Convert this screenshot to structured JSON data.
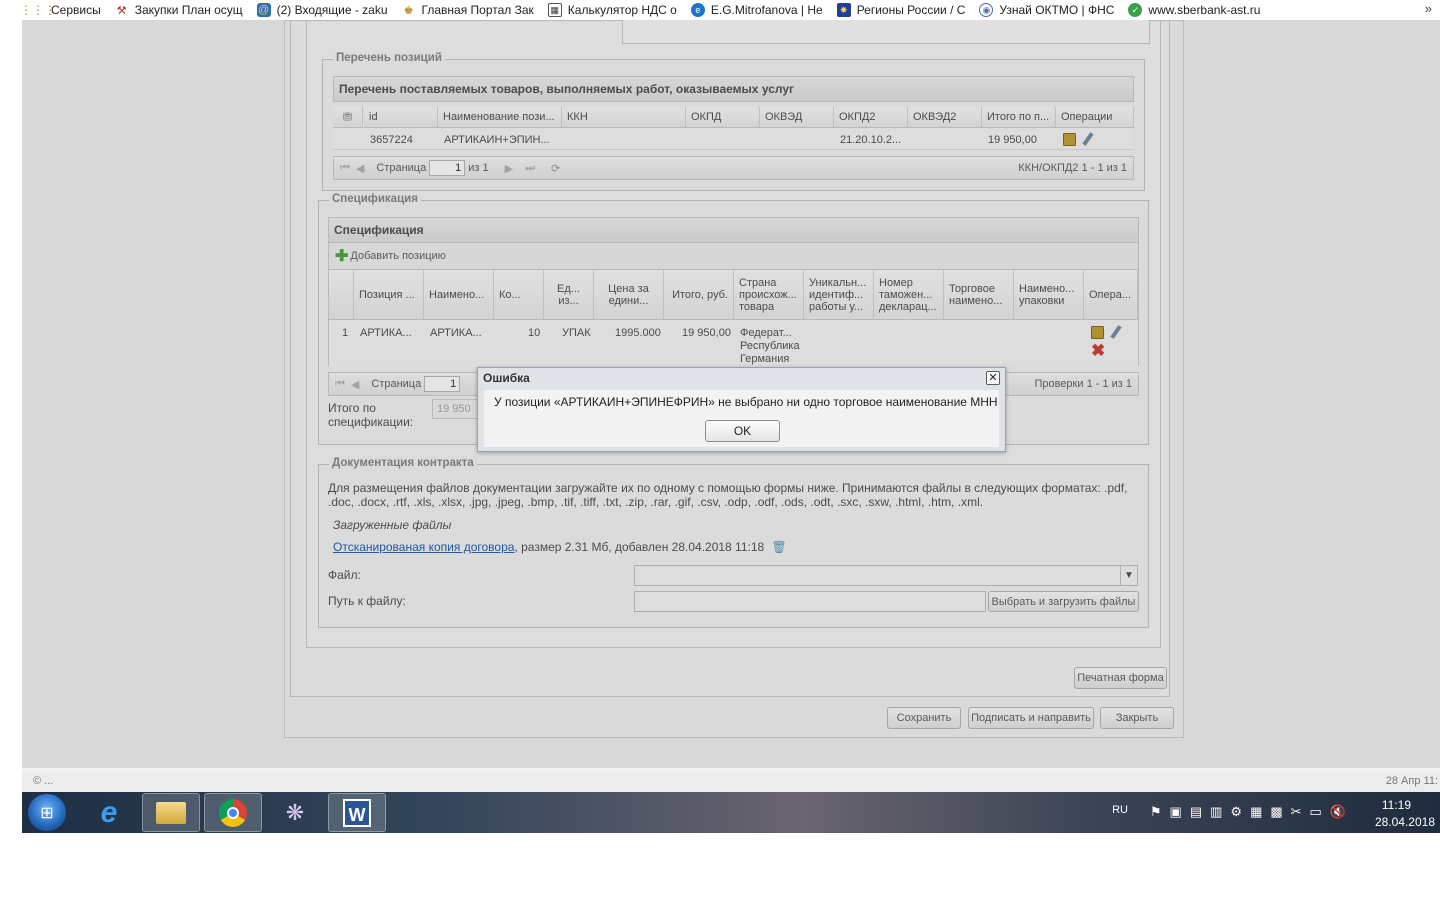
{
  "bookmarks": {
    "apps_label": "Сервисы",
    "items": [
      {
        "label": "Закупки План осущ",
        "icon": "tools-icon"
      },
      {
        "label": "(2) Входящие - zaku",
        "icon": "mail-icon"
      },
      {
        "label": "Главная Портал Зак",
        "icon": "emblem-icon"
      },
      {
        "label": "Калькулятор НДС о",
        "icon": "calculator-icon"
      },
      {
        "label": "E.G.Mitrofanova | Не",
        "icon": "ie-icon"
      },
      {
        "label": "Регионы России / С",
        "icon": "flag-icon"
      },
      {
        "label": "Узнай ОКТМО | ФНС",
        "icon": "fns-icon"
      },
      {
        "label": "www.sberbank-ast.ru",
        "icon": "sberbank-icon"
      }
    ],
    "overflow": "»"
  },
  "positions": {
    "legend": "Перечень позиций",
    "grid_title": "Перечень поставляемых товаров, выполняемых работ, оказываемых услуг",
    "columns": [
      "id",
      "Наименование пози...",
      "ККН",
      "ОКПД",
      "ОКВЭД",
      "ОКПД2",
      "ОКВЭД2",
      "Итого по п...",
      "Операции"
    ],
    "row": {
      "id": "3657224",
      "name": "АРТИКАИН+ЭПИН...",
      "okpd2": "21.20.10.2...",
      "total": "19 950,00"
    },
    "pager": {
      "page_label": "Страница",
      "page_value": "1",
      "of": "из 1",
      "summary": "ККН/ОКПД2 1 - 1 из 1"
    }
  },
  "spec": {
    "legend": "Спецификация",
    "grid_title": "Спецификация",
    "add_label": "Добавить позицию",
    "columns": [
      "Позиция ...",
      "Наимено...",
      "Ко...",
      "Ед... из...",
      "Цена за едини...",
      "Итого, руб.",
      "Страна происхож... товара",
      "Уникальн... идентиф... работы у...",
      "Номер таможен... декларац...",
      "Торговое наимено...",
      "Наимено... упаковки",
      "Опера..."
    ],
    "row": {
      "num": "1",
      "pos": "АРТИКА...",
      "name": "АРТИКА...",
      "qty": "10",
      "unit": "УПАК",
      "price": "1995.000",
      "total": "19 950,00",
      "country1": "Федерат...",
      "country2": "Республика",
      "country3": "Германия"
    },
    "pager": {
      "page_label": "Страница",
      "page_value": "1",
      "summary": "Проверки 1 - 1 из 1"
    },
    "total_label_1": "Итого по",
    "total_label_2": "спецификации:",
    "total_value": "19 950"
  },
  "docs": {
    "legend": "Документация контракта",
    "hint": "Для размещения файлов документации загружайте их по одному с помощью формы ниже. Принимаются файлы в следующих форматах: .pdf, .doc, .docx, .rtf, .xls, .xlsx, .jpg, .jpeg, .bmp, .tif, .tiff, .txt, .zip, .rar, .gif, .csv, .odp, .odf, .ods, .odt, .sxc, .sxw, .html, .htm, .xml.",
    "uploaded_label": "Загруженные файлы",
    "file_link": "Отсканированая копия договора",
    "file_info": ", размер 2.31 Мб, добавлен 28.04.2018 11:18",
    "file_label": "Файл:",
    "path_label": "Путь к файлу:",
    "upload_button": "Выбрать и загрузить файлы"
  },
  "buttons": {
    "print": "Печатная форма",
    "save": "Сохранить",
    "sign": "Подписать и направить",
    "close": "Закрыть"
  },
  "modal": {
    "title": "Ошибка",
    "message": "У позиции «АРТИКАИН+ЭПИНЕФРИН» не выбрано ни одно торговое наименование МНН",
    "ok": "OK"
  },
  "statusbar": {
    "left": "© ...",
    "right": "28 Апр 11:"
  },
  "taskbar": {
    "lang": "RU",
    "time": "11:19",
    "date": "28.04.2018"
  }
}
